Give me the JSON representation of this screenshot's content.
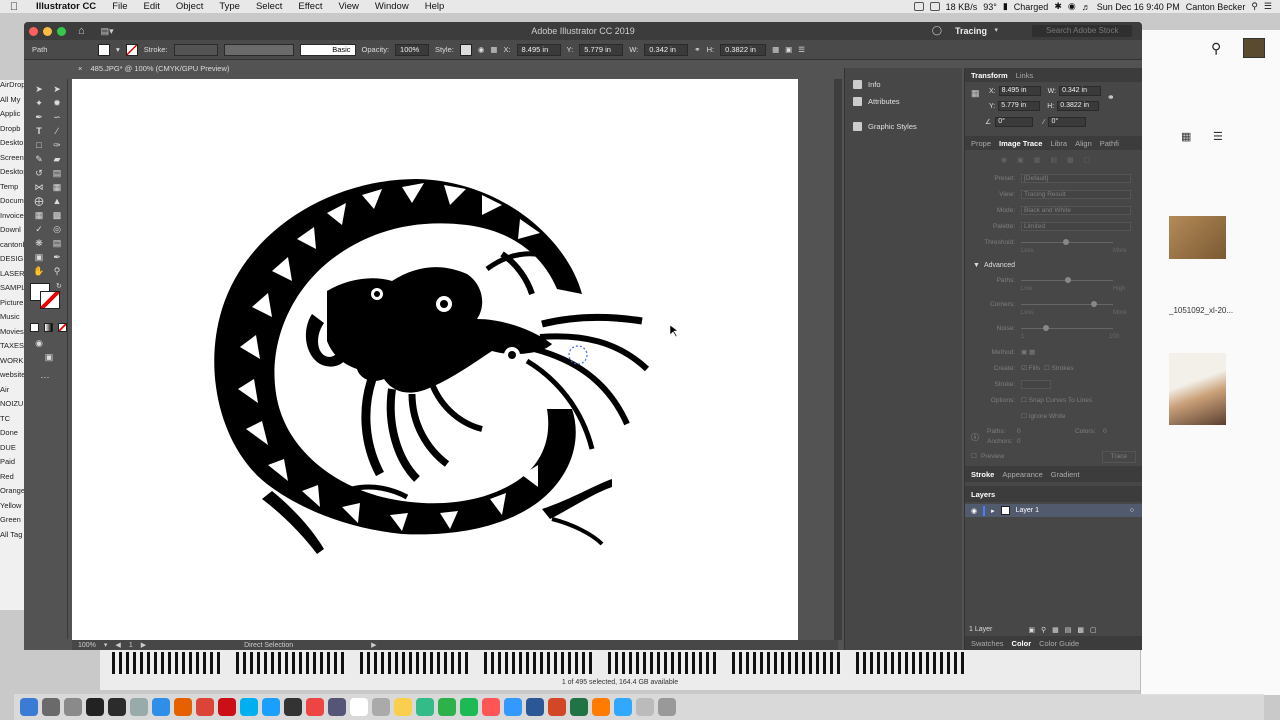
{
  "menubar": {
    "app": "Illustrator CC",
    "items": [
      "File",
      "Edit",
      "Object",
      "Type",
      "Select",
      "Effect",
      "View",
      "Window",
      "Help"
    ],
    "battery": "93°",
    "charge": "Charged",
    "net": "18 KB/s",
    "clock": "Sun Dec 16 9:40 PM",
    "user": "Canton Becker"
  },
  "window": {
    "title": "Adobe Illustrator CC 2019",
    "workspace": "Tracing",
    "search_placeholder": "Search Adobe Stock"
  },
  "controlbar": {
    "selection": "Path",
    "stroke_label": "Stroke:",
    "stroke_style": "Basic",
    "opacity_label": "Opacity:",
    "opacity": "100%",
    "style_label": "Style:",
    "x_label": "X:",
    "x": "8.495 in",
    "y_label": "Y:",
    "y": "5.779 in",
    "w_label": "W:",
    "w": "0.342 in",
    "h_label": "H:",
    "h": "0.3822 in"
  },
  "document": {
    "tab": "485.JPG* @ 100% (CMYK/GPU Preview)"
  },
  "statusbar": {
    "zoom": "100%",
    "page": "1",
    "tool": "Direct Selection"
  },
  "mid_panel": {
    "items": [
      {
        "label": "Info",
        "icon": "info-icon"
      },
      {
        "label": "Attributes",
        "icon": "attributes-icon"
      },
      {
        "label": "Graphic Styles",
        "icon": "graphic-styles-icon"
      }
    ]
  },
  "transform": {
    "tabs": [
      "Transform",
      "Links"
    ],
    "x_label": "X:",
    "x": "8.495 in",
    "y_label": "Y:",
    "y": "5.779 in",
    "w_label": "W:",
    "w": "0.342 in",
    "h_label": "H:",
    "h": "0.3822 in",
    "rotate": "0°",
    "shear": "0°"
  },
  "image_trace": {
    "tabs": [
      "Prope",
      "Image Trace",
      "Libra",
      "Align",
      "Pathfi"
    ],
    "preset_label": "Preset:",
    "preset": "[Default]",
    "view_label": "View:",
    "view": "Tracing Result",
    "mode_label": "Mode:",
    "mode": "Black and White",
    "palette_label": "Palette:",
    "palette": "Limited",
    "threshold_label": "Threshold:",
    "less": "Less",
    "more": "More",
    "advanced": "Advanced",
    "paths_label": "Paths:",
    "low": "Low",
    "high": "High",
    "corners_label": "Corners:",
    "noise_label": "Noise:",
    "noise_min": "1",
    "noise_max": "100",
    "method_label": "Method:",
    "create_label": "Create:",
    "fills": "Fills",
    "strokes": "Strokes",
    "stroke_label": "Stroke:",
    "options_label": "Options:",
    "snap": "Snap Curves To Lines",
    "ignore_white": "Ignore White",
    "paths_count_label": "Paths:",
    "paths_count": "0",
    "colors_label": "Colors:",
    "colors_count": "0",
    "anchors_label": "Anchors:",
    "anchors_count": "0",
    "preview": "Preview",
    "trace_button": "Trace"
  },
  "lower_panels": {
    "tabs": [
      "Stroke",
      "Appearance",
      "Gradient"
    ],
    "layers_tab": "Layers",
    "layer_name": "Layer 1",
    "layer_count": "1 Layer",
    "bottom_tabs": [
      "Swatches",
      "Color",
      "Color Guide"
    ]
  },
  "finder_sidebar": [
    "AirDrop",
    "All My",
    "Applic",
    "Dropb",
    "Deskto",
    "Screen",
    "Desktop",
    "Temp",
    "Docum",
    "Invoice",
    "Downl",
    "cantonb",
    "DESIGN",
    "LASER",
    "SAMPLE",
    "Picture",
    "Music",
    "Movies",
    "TAXES",
    "WORK",
    "website",
    "Air",
    "NOIZU",
    "TC",
    "Done",
    "DUE",
    "Paid",
    "Red",
    "Orange",
    "Yellow",
    "Green",
    "All Tag"
  ],
  "finder_right": {
    "file_label": "_1051092_xl-20..."
  },
  "file_strip": {
    "status": "1 of 495 selected, 164.4 GB available"
  }
}
